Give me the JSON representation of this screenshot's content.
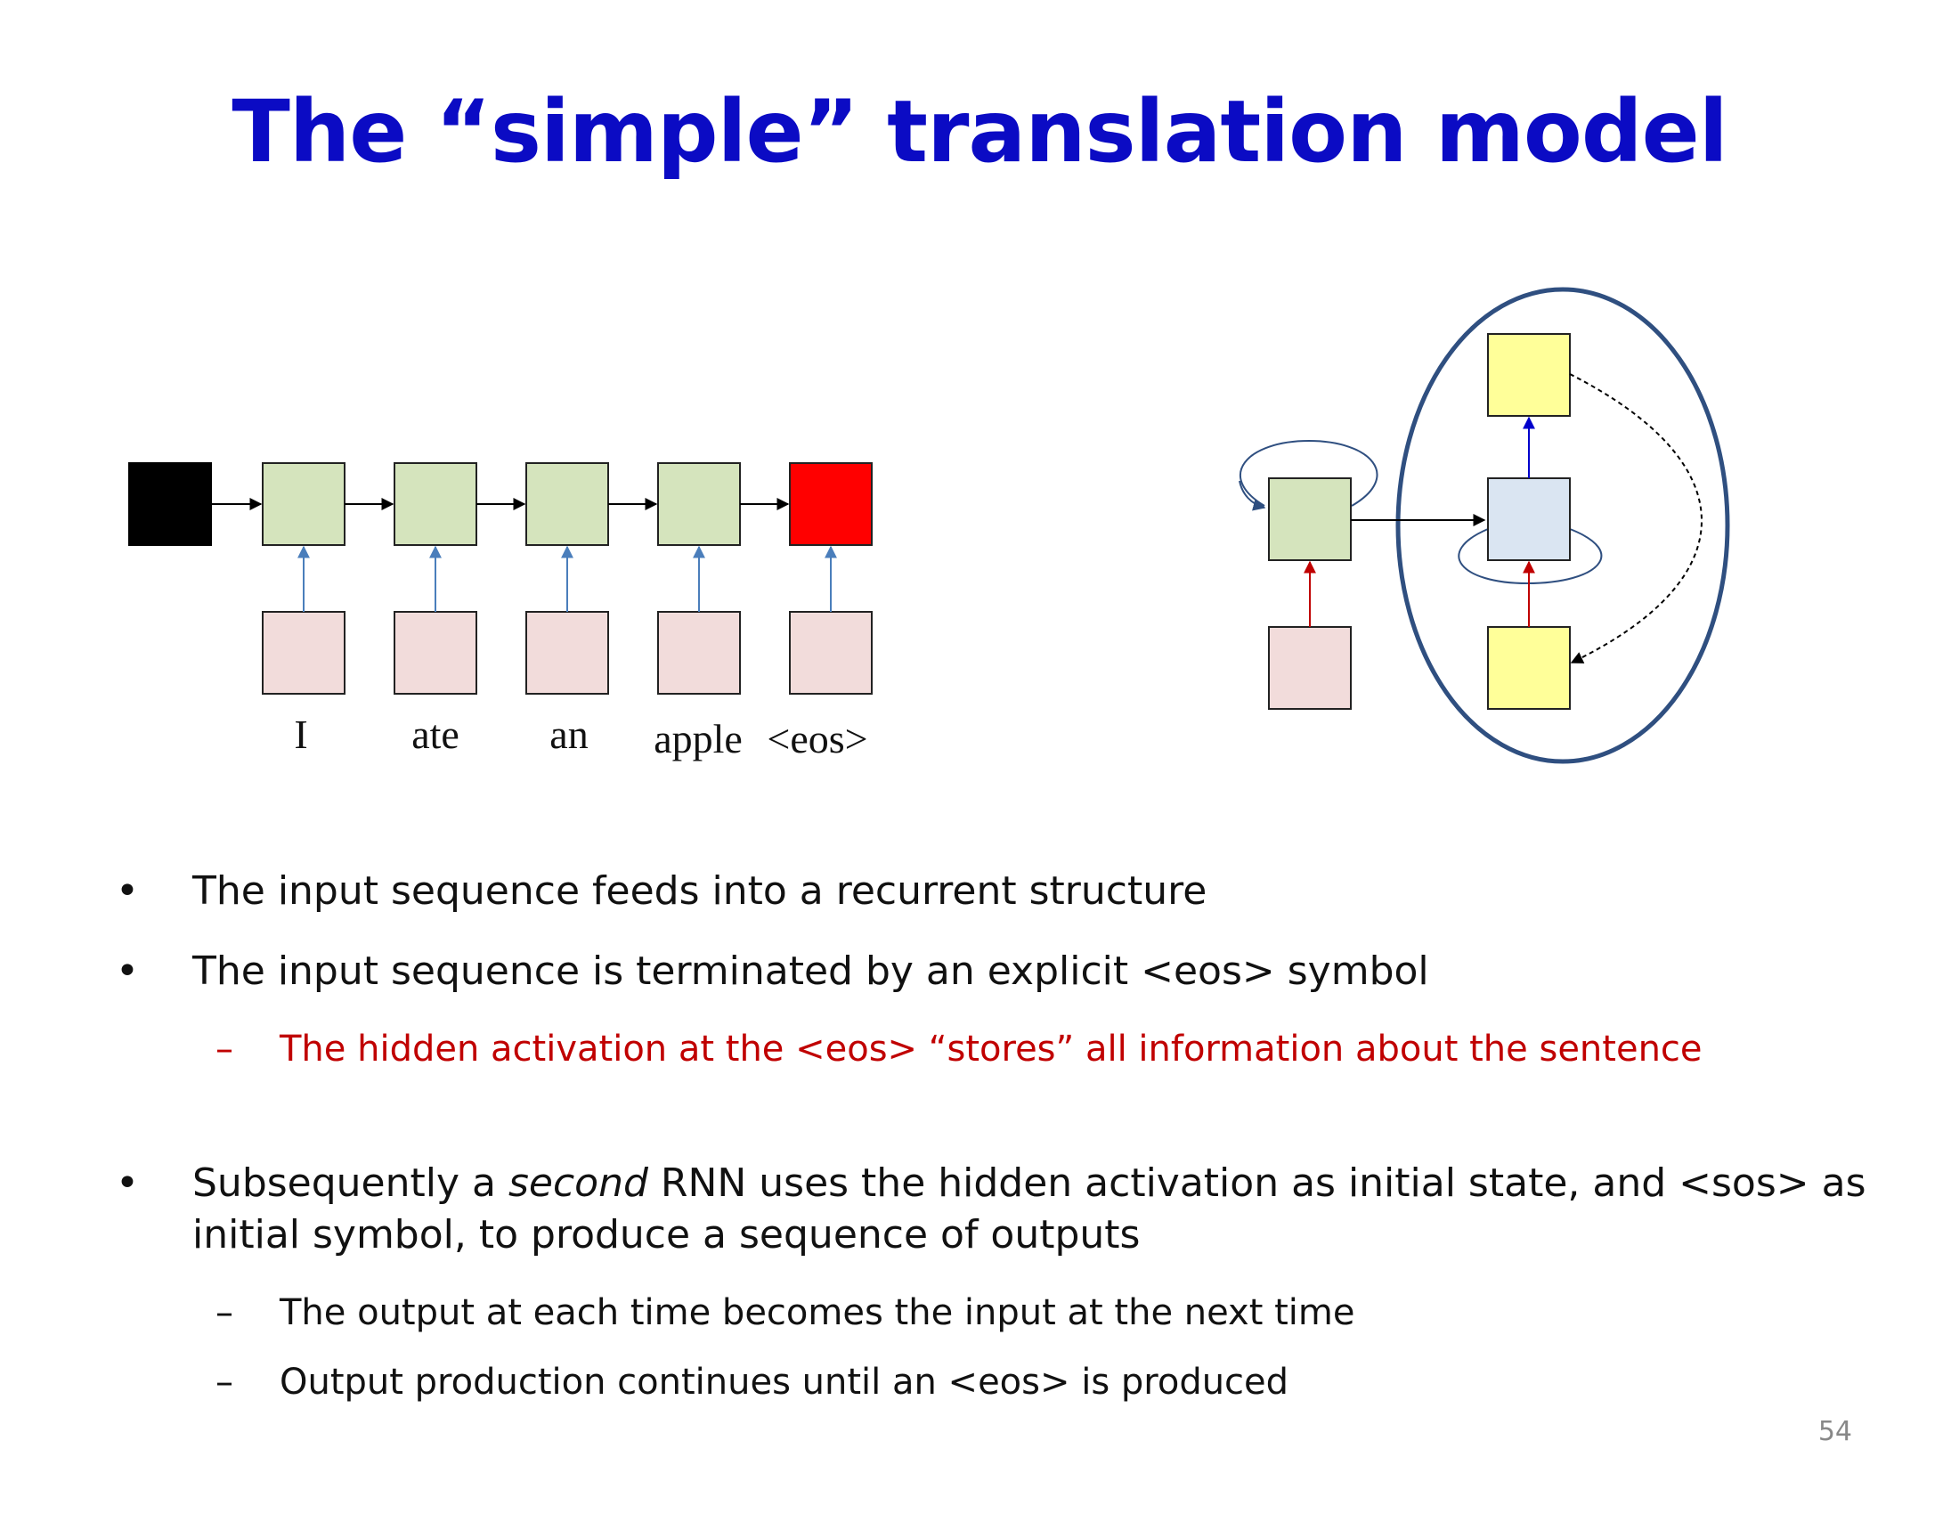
{
  "title": "The “simple” translation model",
  "encoder": {
    "words": [
      "I",
      "ate",
      "an",
      "apple",
      "<eos>"
    ]
  },
  "bullets": [
    {
      "text": "The input sequence feeds into a recurrent structure",
      "subs": []
    },
    {
      "text": "The input sequence is terminated by an explicit <eos> symbol",
      "subs": [
        {
          "text": "The hidden activation at the <eos> “stores” all information about the sentence",
          "color": "#c00000"
        }
      ]
    },
    {
      "text_before": "Subsequently a ",
      "text_italic": "second",
      "text_after": " RNN uses the hidden activation as initial state, and <sos> as initial symbol, to produce a sequence of outputs",
      "subs": [
        {
          "text": "The output at each time becomes the input at the next time"
        },
        {
          "text": "Output production continues until an <eos> is produced"
        }
      ]
    }
  ],
  "bullet_symbol": "•",
  "dash_symbol": "–",
  "page_number": "54",
  "colors": {
    "title": "#0b0bc4",
    "initial_state": "#000000",
    "hidden_unit": "#d5e4bd",
    "final_hidden": "#ff0000",
    "input_unit": "#f2dcdb",
    "decoder_hidden": "#dae5f2",
    "decoder_io": "#ffff99",
    "ellipse": "#2f4f80",
    "red_text": "#c00000"
  }
}
